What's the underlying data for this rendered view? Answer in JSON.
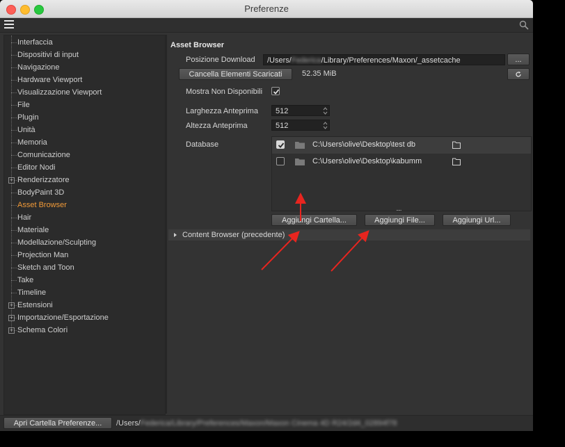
{
  "window": {
    "title": "Preferenze"
  },
  "sidebar": {
    "items": [
      {
        "label": "Interfaccia",
        "expandable": false
      },
      {
        "label": "Dispositivi di input",
        "expandable": false
      },
      {
        "label": "Navigazione",
        "expandable": false
      },
      {
        "label": "Hardware Viewport",
        "expandable": false
      },
      {
        "label": "Visualizzazione Viewport",
        "expandable": false
      },
      {
        "label": "File",
        "expandable": false
      },
      {
        "label": "Plugin",
        "expandable": false
      },
      {
        "label": "Unità",
        "expandable": false
      },
      {
        "label": "Memoria",
        "expandable": false
      },
      {
        "label": "Comunicazione",
        "expandable": false
      },
      {
        "label": "Editor Nodi",
        "expandable": false
      },
      {
        "label": "Renderizzatore",
        "expandable": true
      },
      {
        "label": "BodyPaint 3D",
        "expandable": false
      },
      {
        "label": "Asset Browser",
        "expandable": false,
        "selected": true
      },
      {
        "label": "Hair",
        "expandable": false
      },
      {
        "label": "Materiale",
        "expandable": false
      },
      {
        "label": "Modellazione/Sculpting",
        "expandable": false
      },
      {
        "label": "Projection Man",
        "expandable": false
      },
      {
        "label": "Sketch and Toon",
        "expandable": false
      },
      {
        "label": "Take",
        "expandable": false
      },
      {
        "label": "Timeline",
        "expandable": false
      },
      {
        "label": "Estensioni",
        "expandable": true
      },
      {
        "label": "Importazione/Esportazione",
        "expandable": true
      },
      {
        "label": "Schema Colori",
        "expandable": true
      }
    ],
    "selected_color": "#f19a38"
  },
  "asset_browser": {
    "heading": "Asset Browser",
    "download_label": "Posizione Download",
    "download_path_prefix": "/Users/",
    "download_path_user": "Federica",
    "download_path_suffix": "/Library/Preferences/Maxon/_assetcache",
    "browse_label": "...",
    "clear_button": "Cancella Elementi Scaricati",
    "cache_size": "52.35 MiB",
    "show_unavailable_label": "Mostra Non Disponibili",
    "show_unavailable_checked": true,
    "preview_width_label": "Larghezza Anteprima",
    "preview_width_value": "512",
    "preview_height_label": "Altezza Anteprima",
    "preview_height_value": "512",
    "database_label": "Database",
    "databases": [
      {
        "path": "C:\\Users\\olive\\Desktop\\test db",
        "checked": true
      },
      {
        "path": "C:\\Users\\olive\\Desktop\\kabumm",
        "checked": false
      }
    ],
    "grip_label": ".....",
    "add_folder_button": "Aggiungi Cartella...",
    "add_file_button": "Aggiungi File...",
    "add_url_button": "Aggiungi Url..."
  },
  "content_browser": {
    "label": "Content Browser (precedente)"
  },
  "statusbar": {
    "open_folder_button": "Apri Cartella Preferenze...",
    "path_prefix": "/Users/",
    "path_blurred": "Federica/Library/Preferences/Maxon/Maxon Cinema 4D R24/2d4_02894f78"
  },
  "colors": {
    "accent": "#f19a38",
    "annotation_arrow": "#e8251f",
    "panel": "#333333"
  }
}
